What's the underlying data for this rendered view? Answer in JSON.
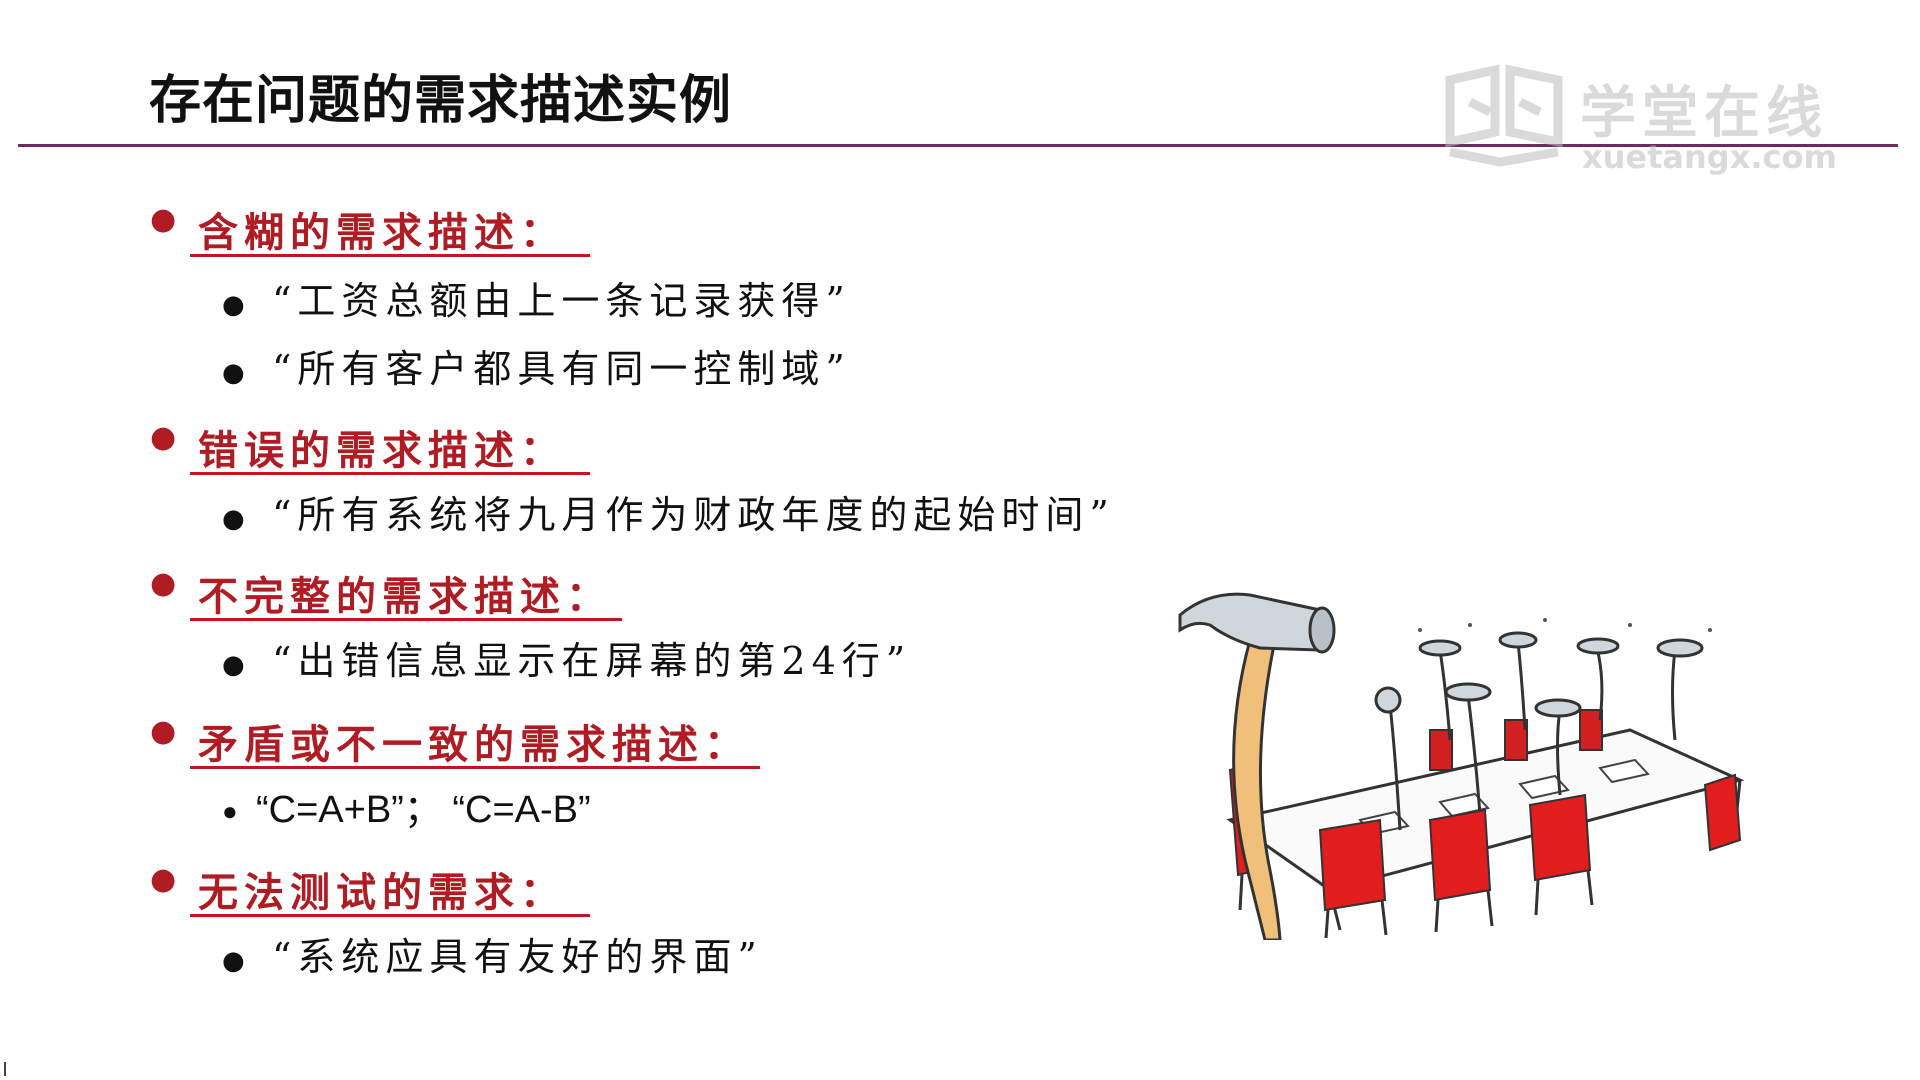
{
  "title": "存在问题的需求描述实例",
  "logo": {
    "cn": "学堂在线",
    "en": "xuetangx.com"
  },
  "sections": [
    {
      "heading": "含糊的需求描述：",
      "items": [
        "“工资总额由上一条记录获得”",
        "“所有客户都具有同一控制域”"
      ]
    },
    {
      "heading": "错误的需求描述：",
      "items": [
        "“所有系统将九月作为财政年度的起始时间”"
      ]
    },
    {
      "heading": "不完整的需求描述：",
      "items": [
        "“出错信息显示在屏幕的第24行”"
      ]
    },
    {
      "heading": "矛盾或不一致的需求描述：",
      "items": [
        "“C=A+B”；  “C=A-B”"
      ]
    },
    {
      "heading": "无法测试的需求：",
      "items": [
        "“系统应具有友好的界面”"
      ]
    }
  ],
  "illustration": {
    "icon": "hammer-and-nails-meeting-cartoon"
  },
  "colors": {
    "accent": "#c4161c",
    "rule": "#6b2d5c"
  }
}
